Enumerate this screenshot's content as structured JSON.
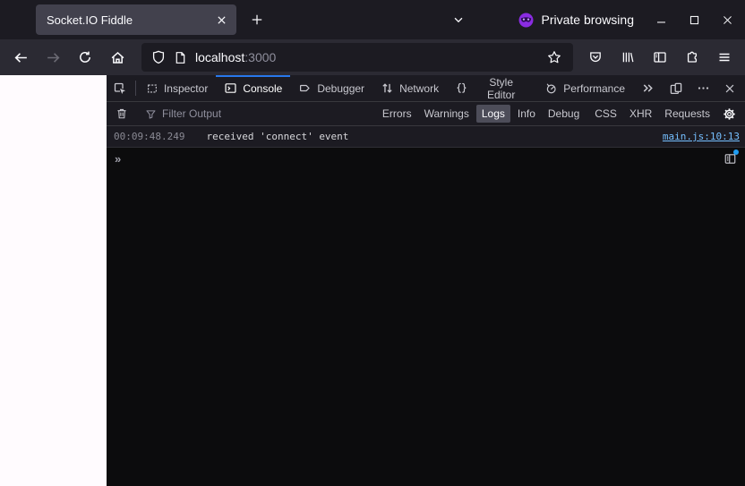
{
  "window": {
    "tab_title": "Socket.IO Fiddle",
    "private_label": "Private browsing"
  },
  "navbar": {
    "url_host": "localhost",
    "url_port": ":3000"
  },
  "devtools": {
    "tabs": [
      "Inspector",
      "Console",
      "Debugger",
      "Network",
      "Style Editor",
      "Performance"
    ],
    "active_tab": "Console",
    "filter": {
      "placeholder": "Filter Output",
      "levels": [
        "Errors",
        "Warnings",
        "Logs",
        "Info",
        "Debug"
      ],
      "active_level": "Logs",
      "categories": [
        "CSS",
        "XHR",
        "Requests"
      ]
    },
    "console": {
      "log": {
        "timestamp": "00:09:48.249",
        "message": "received 'connect' event",
        "source_link": "main.js:10:13"
      },
      "prompt": "»"
    }
  },
  "colors": {
    "accent_blue": "#2878eb",
    "link_blue": "#75bfff",
    "notification_blue": "#1f9cf0",
    "private_purple": "#8a2ce2",
    "tab_bg": "#42414d",
    "titlebar_bg": "#1c1b22",
    "navbar_bg": "#2b2a33",
    "console_bg": "#0c0c0d",
    "page_bg": "#fffbfe"
  },
  "icons": [
    "tab-close-icon",
    "new-tab-icon",
    "tab-list-chevron-icon",
    "private-mask-icon",
    "minimize-icon",
    "maximize-icon",
    "close-icon",
    "back-icon",
    "forward-icon",
    "reload-icon",
    "home-icon",
    "shield-icon",
    "page-icon",
    "star-icon",
    "pocket-icon",
    "library-icon",
    "sidebar-icon",
    "extensions-icon",
    "menu-icon",
    "pick-element-icon",
    "inspector-icon",
    "console-icon",
    "debugger-icon",
    "network-icon",
    "style-editor-icon",
    "performance-icon",
    "more-tabs-icon",
    "responsive-mode-icon",
    "meatball-menu-icon",
    "trash-icon",
    "filter-funnel-icon",
    "gear-icon",
    "console-sidebar-toggle-icon"
  ]
}
